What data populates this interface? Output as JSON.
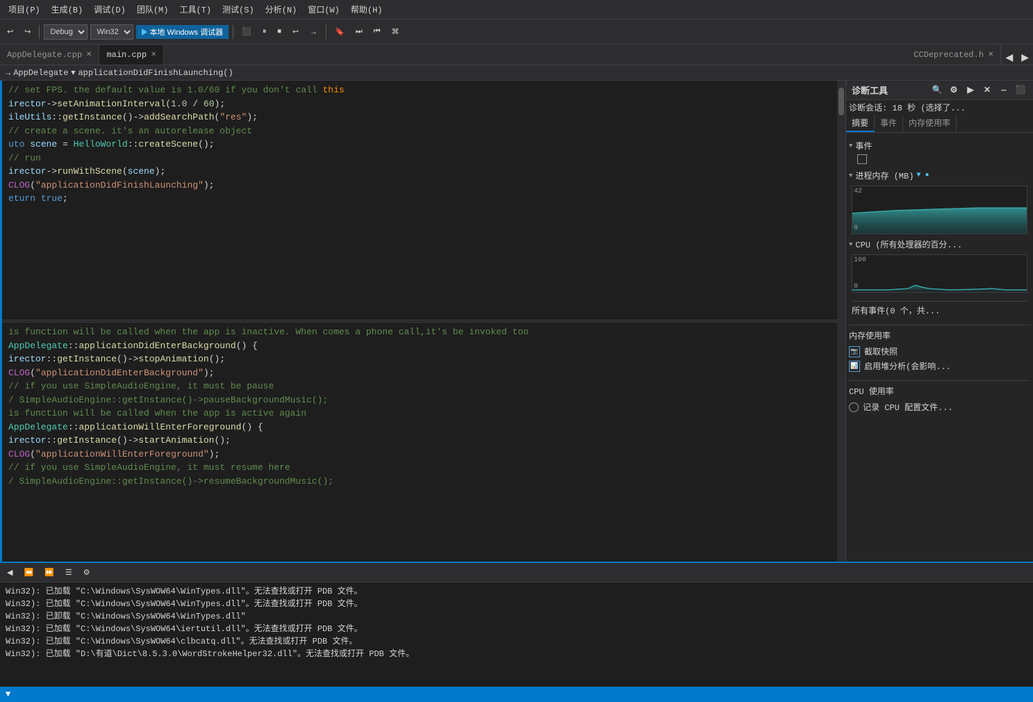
{
  "menubar": {
    "items": [
      "项目(P)",
      "生成(B)",
      "调试(D)",
      "团队(M)",
      "工具(T)",
      "测试(S)",
      "分析(N)",
      "窗口(W)",
      "帮助(H)"
    ]
  },
  "toolbar": {
    "undo": "↩",
    "redo": "↪",
    "debug_mode": "Debug",
    "platform": "Win32",
    "run_label": "本地 Windows 调试器",
    "icons": [
      "▶",
      "⏸",
      "⏹",
      "↩",
      "→"
    ]
  },
  "tabs": [
    {
      "label": "AppDelegate.cpp",
      "active": false,
      "modified": false
    },
    {
      "label": "main.cpp",
      "active": true,
      "modified": false
    }
  ],
  "breadcrumb": {
    "parts": [
      "→  AppDelegate",
      "▾  applicationDidFinishLaunching()"
    ]
  },
  "diag_panel": {
    "title": "诊断工具",
    "summary": "诊断会话: 18 秒 (选择了...",
    "sections": {
      "events": "事件",
      "memory": "进程内存 (MB)",
      "cpu": "CPU (所有处理器的百分..."
    },
    "memory_max": "42",
    "memory_min": "0",
    "cpu_max": "100",
    "cpu_min": "0",
    "tabs": [
      "摘要",
      "事件",
      "内存使用率"
    ],
    "events_label": "所有事件(0 个，共...",
    "memory_section": "内存使用率",
    "memory_snapshot": "截取快照",
    "memory_analyze": "启用堆分析(会影响...",
    "cpu_section": "CPU 使用率",
    "cpu_record": "记录 CPU 配置文件..."
  },
  "code_sections": {
    "section1": [
      "// set FPS. the default value is 1.0/60 if you don't call this",
      "irector->setAnimationInterval(1.0 / 60);",
      "",
      "ileUtils::getInstance()->addSearchPath(\"res\");",
      "",
      "// create a scene. it's an autorelease object",
      "uto scene = HelloWorld::createScene();",
      "",
      "// run",
      "irector->runWithScene(scene);",
      "",
      "CLOG(\"applicationDidFinishLaunching\");",
      "",
      "eturn true;"
    ],
    "section2": [
      "is function will be called when the app is inactive. When comes a phone call,it's be invoked too",
      "AppDelegate::applicationDidEnterBackground() {",
      "irector::getInstance()->stopAnimation();",
      "CLOG(\"applicationDidEnterBackground\");",
      "",
      "// if you use SimpleAudioEngine, it must be pause",
      "/ SimpleAudioEngine::getInstance()->pauseBackgroundMusic();",
      "",
      "is function will be called when the app is active again",
      "AppDelegate::applicationWillEnterForeground() {",
      "irector::getInstance()->startAnimation();",
      "CLOG(\"applicationWillEnterForeground\");",
      "",
      "// if you use SimpleAudioEngine, it must resume here",
      "/ SimpleAudioEngine::getInstance()->resumeBackgroundMusic();"
    ]
  },
  "output": {
    "lines": [
      "Win32): 已加载 \"C:\\Windows\\SysWOW64\\WinTypes.dll\"。无法查找或打开 PDB 文件。",
      "Win32): 已加载 \"C:\\Windows\\SysWOW64\\WinTypes.dll\"。无法查找或打开 PDB 文件。",
      "Win32): 已卸载 \"C:\\Windows\\SysWOW64\\WinTypes.dll\"",
      "Win32): 已加载 \"C:\\Windows\\SysWOW64\\iertutil.dll\"。无法查找或打开 PDB 文件。",
      "Win32): 已加载 \"C:\\Windows\\SysWOW64\\clbcatq.dll\"。无法查找或打开 PDB 文件。",
      "Win32): 已加载 \"D:\\有道\\Dict\\8.5.3.0\\WordStrokeHelper32.dll\"。无法查找或打开 PDB 文件。"
    ]
  },
  "file_tabs": {
    "CCDeprecated": "CCDeprecated.h"
  }
}
